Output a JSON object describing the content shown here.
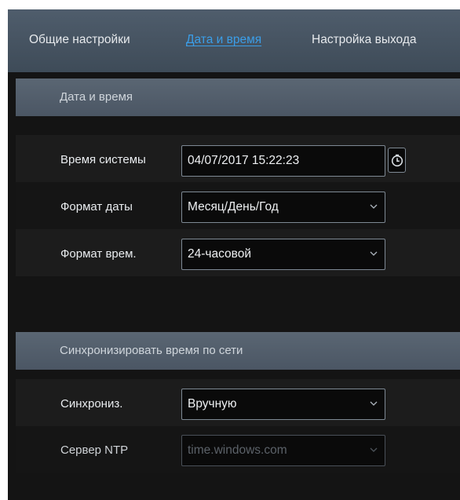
{
  "tabs": [
    {
      "label": "Общие настройки"
    },
    {
      "label": "Дата и время"
    },
    {
      "label": "Настройка выхода"
    }
  ],
  "active_tab": "Дата и время",
  "date_time_section": {
    "title": "Дата и время",
    "system_time": {
      "label": "Время системы",
      "value": "04/07/2017 15:22:23"
    },
    "date_format": {
      "label": "Формат даты",
      "value": "Месяц/День/Год"
    },
    "time_format": {
      "label": "Формат врем.",
      "value": "24-часовой"
    }
  },
  "sync_section": {
    "title": "Синхронизировать время по сети",
    "sync_mode": {
      "label": "Синхрониз.",
      "value": "Вручную"
    },
    "ntp_server": {
      "label": "Сервер NTP",
      "value": "time.windows.com",
      "enabled": false
    }
  },
  "colors": {
    "accent": "#3b9ee8",
    "header_bar": "#4f5d6c",
    "section_header": "#5a6673",
    "panel_background": "#141414"
  }
}
